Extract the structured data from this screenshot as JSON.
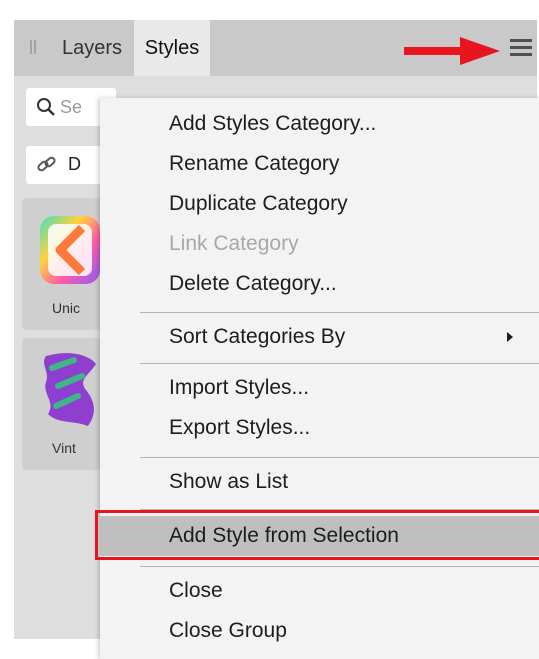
{
  "panel": {
    "tabs": [
      {
        "label": "Layers",
        "active": false
      },
      {
        "label": "Styles",
        "active": true
      }
    ]
  },
  "search": {
    "placeholder": "Se"
  },
  "category_selector": {
    "label": "D"
  },
  "styles": [
    {
      "label": "Unic"
    },
    {
      "label": "Vint"
    }
  ],
  "menu": {
    "items": [
      {
        "label": "Add Styles Category...",
        "enabled": true
      },
      {
        "label": "Rename Category",
        "enabled": true
      },
      {
        "label": "Duplicate Category",
        "enabled": true
      },
      {
        "label": "Link Category",
        "enabled": false
      },
      {
        "label": "Delete Category...",
        "enabled": true
      },
      {
        "label": "Sort Categories By",
        "enabled": true,
        "submenu": true
      },
      {
        "label": "Import Styles...",
        "enabled": true
      },
      {
        "label": "Export Styles...",
        "enabled": true
      },
      {
        "label": "Show as List",
        "enabled": true
      },
      {
        "label": "Add Style from Selection",
        "enabled": true,
        "highlighted": true
      },
      {
        "label": "Close",
        "enabled": true
      },
      {
        "label": "Close Group",
        "enabled": true
      }
    ]
  },
  "colors": {
    "annotation_red": "#e8141e",
    "panel_bg": "#dedede",
    "menu_bg": "#f3f3f3",
    "highlight_bg": "#bfbfbf"
  },
  "icons": [
    "grip-icon",
    "red-arrow-icon",
    "hamburger-menu-icon",
    "search-icon",
    "link-icon",
    "submenu-arrow-icon"
  ]
}
